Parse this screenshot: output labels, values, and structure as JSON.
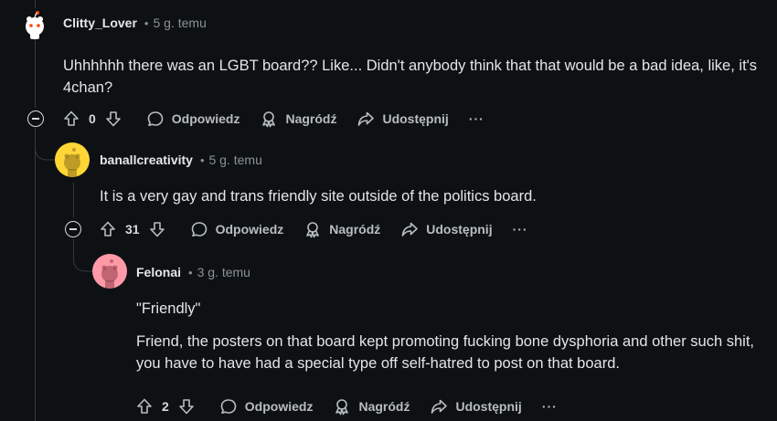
{
  "comments": [
    {
      "author": "Clitty_Lover",
      "time": "5 g. temu",
      "body": [
        "Uhhhhhh there was an LGBT board?? Like... Didn't anybody think that that would be a bad idea, like, it's 4chan?"
      ],
      "votes": "0",
      "avatar_bg": "#ffffff"
    },
    {
      "author": "banallcreativity",
      "time": "5 g. temu",
      "body": [
        "It is a very gay and trans friendly site outside of the politics board."
      ],
      "votes": "31",
      "avatar_bg": "#ffd635"
    },
    {
      "author": "Felonai",
      "time": "3 g. temu",
      "body": [
        "\"Friendly\"",
        "Friend, the posters on that board kept promoting fucking bone dysphoria and other such shit, you have to have had a special type off self-hatred to post on that board."
      ],
      "votes": "2",
      "avatar_bg": "#ff99a8"
    }
  ],
  "actions": {
    "reply": "Odpowiedz",
    "award": "Nagródź",
    "share": "Udostępnij",
    "more": "···"
  },
  "icons": [
    "upvote-icon",
    "downvote-icon",
    "reply-icon",
    "award-icon",
    "share-icon",
    "collapse-icon",
    "more-icon"
  ]
}
